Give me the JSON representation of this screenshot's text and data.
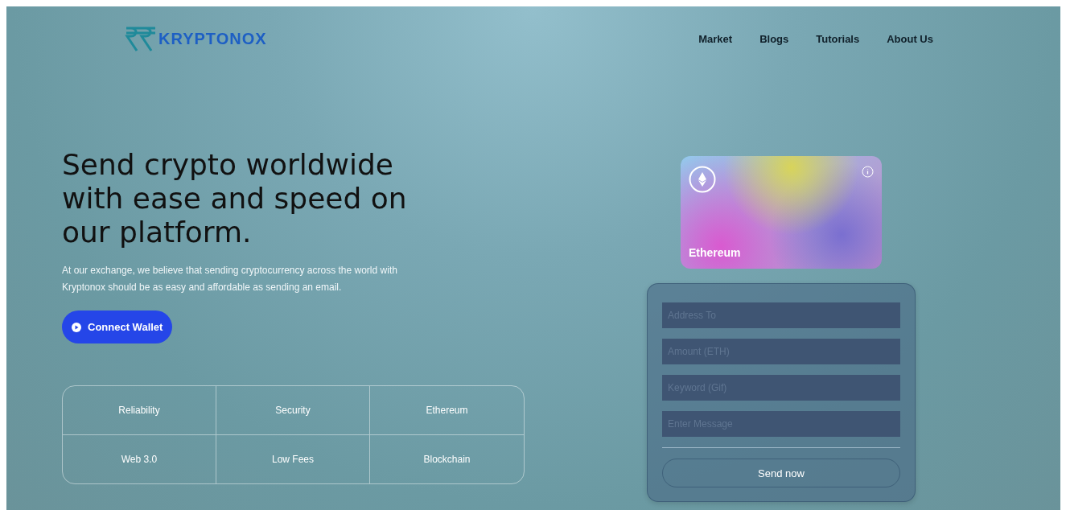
{
  "logo": {
    "text": "KRYPTONOX"
  },
  "nav": [
    "Market",
    "Blogs",
    "Tutorials",
    "About Us"
  ],
  "hero": {
    "title": "Send crypto worldwide with ease and speed on our platform.",
    "subtitle": "At our exchange, we believe that sending cryptocurrency across the world with Kryptonox should be as easy and affordable as sending an email.",
    "button": "Connect Wallet"
  },
  "features": [
    "Reliability",
    "Security",
    "Ethereum",
    "Web 3.0",
    "Low Fees",
    "Blockchain"
  ],
  "card": {
    "name": "Ethereum"
  },
  "form": {
    "fields": [
      {
        "placeholder": "Address To"
      },
      {
        "placeholder": "Amount (ETH)"
      },
      {
        "placeholder": "Keyword (Gif)"
      },
      {
        "placeholder": "Enter Message"
      }
    ],
    "button": "Send now"
  }
}
